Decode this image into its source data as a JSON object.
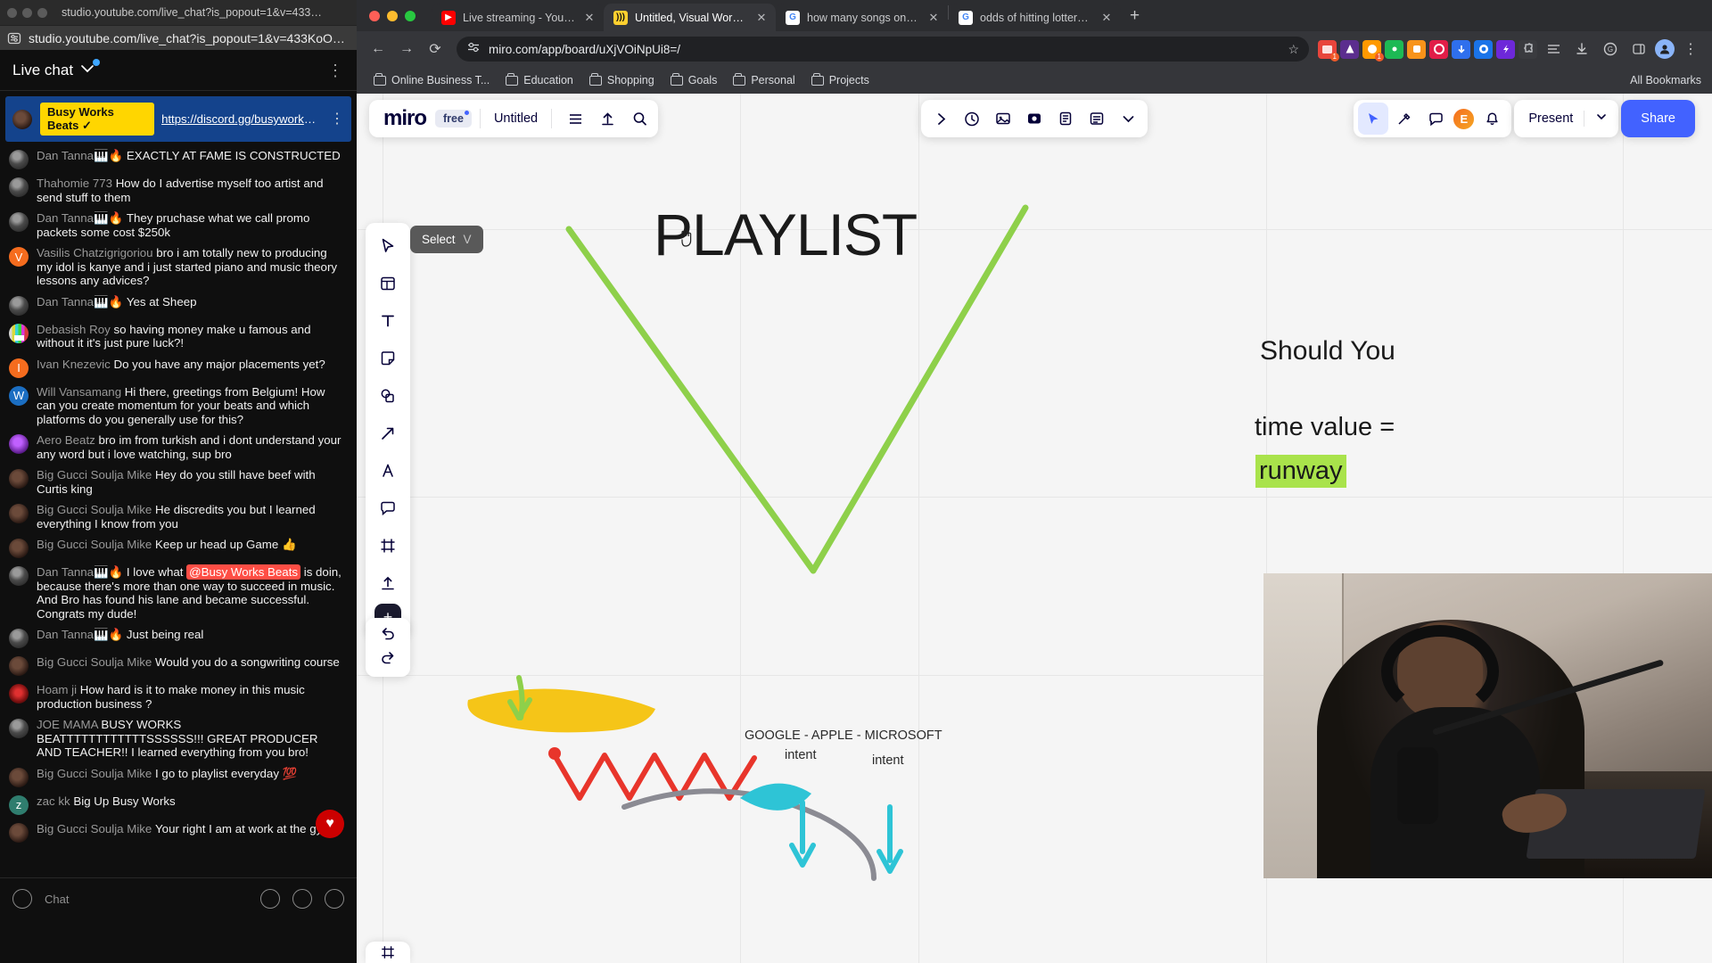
{
  "ytchat": {
    "window_titlebar_url": "studio.youtube.com/live_chat?is_popout=1&v=433KoOJW...",
    "address_bar_url": "studio.youtube.com/live_chat?is_popout=1&v=433KoOJW...",
    "header": {
      "title": "Live chat",
      "chevron": "⌄",
      "menu_icon": "⋮"
    },
    "pinned": {
      "author": "Busy Works Beats",
      "verified": "✓",
      "link": "https://discord.gg/busyworksbea...",
      "menu_icon": "⋮"
    },
    "messages": [
      {
        "author": "Dan Tanna🎹🔥",
        "text": "EXACTLY AT FAME IS CONSTRUCTED",
        "avatar": "dark"
      },
      {
        "author": "Thahomie 773",
        "text": "How do I advertise myself too artist and send stuff to them",
        "avatar": "dark"
      },
      {
        "author": "Dan Tanna🎹🔥",
        "text": "They pruchase what we call promo packets some cost $250k",
        "avatar": "dark"
      },
      {
        "author": "Vasilis Chatzigrigoriou",
        "text": "bro i am totally new to producing my idol is kanye and i just started piano and music theory lessons any advices?",
        "avatar": "orange",
        "letter": "V"
      },
      {
        "author": "Dan Tanna🎹🔥",
        "text": "Yes at Sheep",
        "avatar": "dark"
      },
      {
        "author": "Debasish Roy",
        "text": "so having money make u famous and without it it's just pure luck?!",
        "avatar": "bars"
      },
      {
        "author": "Ivan Knezevic",
        "text": "Do you have any major placements yet?",
        "avatar": "orange",
        "letter": "I"
      },
      {
        "author": "Will Vansamang",
        "text": "Hi there, greetings from Belgium! How can you create momentum for your beats and which platforms do you generally use for this?",
        "avatar": "blue",
        "letter": "W"
      },
      {
        "author": "Aero Beatz",
        "text": "bro im from turkish and i dont understand your any word but i love watching, sup bro",
        "avatar": "purple"
      },
      {
        "author": "Big Gucci Soulja Mike",
        "text": "Hey do you still have beef with Curtis king",
        "avatar": "photo"
      },
      {
        "author": "Big Gucci Soulja Mike",
        "text": "He discredits you but I learned everything I know from you",
        "avatar": "photo"
      },
      {
        "author": "Big Gucci Soulja Mike",
        "text": "Keep ur head up Game  👍",
        "avatar": "photo"
      },
      {
        "author": "Dan Tanna🎹🔥",
        "text_before": "I love what ",
        "mention": "@Busy Works Beats",
        "text_after": " is doin, because there's more than one way to succeed in music. And Bro has found his lane and became successful. Congrats my dude!",
        "avatar": "dark"
      },
      {
        "author": "Dan Tanna🎹🔥",
        "text": "Just being real",
        "avatar": "dark"
      },
      {
        "author": "Big Gucci Soulja Mike",
        "text": "Would you do a songwriting course",
        "avatar": "photo"
      },
      {
        "author": "Hoam ji",
        "text": "How hard is it to make money in this music production business ?",
        "avatar": "red"
      },
      {
        "author": "JOE MAMA",
        "text": "BUSY WORKS BEATTTTTTTTTTTTSSSSSS!!! GREAT PRODUCER AND TEACHER!! I learned everything from you bro!",
        "avatar": "dark"
      },
      {
        "author": "Big Gucci Soulja Mike",
        "text": "I go to playlist everyday 💯",
        "avatar": "photo"
      },
      {
        "author": "zac kk",
        "text": "Big Up Busy Works",
        "avatar": "z",
        "letter": "z"
      },
      {
        "author": "Big Gucci Soulja Mike",
        "text": "Your right I am at work at the gym",
        "avatar": "photo"
      }
    ],
    "heart_button_icon": "♥",
    "footer": {
      "chat_label": "Chat",
      "icons": [
        "emoji-icon",
        "gif-icon",
        "dollar-icon"
      ]
    }
  },
  "browser": {
    "window_controls": [
      "close",
      "minimize",
      "maximize"
    ],
    "tabs": [
      {
        "title": "Live streaming - YouTube Stu",
        "favicon": "youtube-icon",
        "active": false,
        "close": "✕"
      },
      {
        "title": "Untitled, Visual Workspace fo",
        "favicon": "miro-icon",
        "active": true,
        "close": "✕"
      },
      {
        "title": "how many songs on spotify -",
        "favicon": "google-icon",
        "active": false,
        "close": "✕"
      },
      {
        "title": "odds of hitting lottery - Goog",
        "favicon": "google-icon",
        "active": false,
        "close": "✕"
      }
    ],
    "new_tab_icon": "+",
    "nav": {
      "back": "←",
      "forward": "→",
      "reload": "⟳",
      "site_info": "site-settings-icon",
      "url": "miro.com/app/board/uXjVOiNpUi8=/",
      "bookmark_star": "☆"
    },
    "bookmarks": [
      {
        "label": "Online Business T..."
      },
      {
        "label": "Education"
      },
      {
        "label": "Shopping"
      },
      {
        "label": "Goals"
      },
      {
        "label": "Personal"
      },
      {
        "label": "Projects"
      }
    ],
    "all_bookmarks_label": "All Bookmarks"
  },
  "miro": {
    "logo": "miro",
    "plan_chip": "free",
    "board_title": "Untitled",
    "topbar_icons": [
      "menu-icon",
      "upload-icon",
      "search-icon"
    ],
    "center_tools": [
      "chevron-right-icon",
      "timer-icon",
      "frame-icon",
      "focus-icon",
      "voting-icon",
      "notes-icon",
      "chevron-down-icon"
    ],
    "right_tools": [
      "cursor-icon",
      "magic-icon",
      "comment-icon"
    ],
    "user_initial": "E",
    "notification_icon": "bell-icon",
    "present_label": "Present",
    "present_chevron": "⌄",
    "share_label": "Share",
    "tooltip": {
      "label": "Select",
      "shortcut": "V"
    },
    "toolbar_tools": [
      "cursor-select-icon",
      "templates-icon",
      "text-icon",
      "sticky-note-icon",
      "shapes-icon",
      "arrow-icon",
      "pen-icon",
      "comment-icon",
      "frame-icon",
      "upload-icon",
      "more-apps-icon"
    ],
    "history_tools": [
      "undo-icon",
      "redo-icon"
    ],
    "canvas": {
      "title": "PLAYLIST",
      "right_text_1": "Should You",
      "right_text_2": "time value =",
      "highlight_text": "runway",
      "label_companies": "GOOGLE - APPLE - MICROSOFT",
      "label_intent_1": "intent",
      "label_intent_2": "intent",
      "chart_color": "#8ed04a",
      "highlight_color": "#a9e34b",
      "yellow_color": "#f5c518",
      "red_color": "#e8352b",
      "cyan_color": "#2ec4d6",
      "cursor": "grab-hand-icon"
    }
  },
  "webcam": {
    "present": true,
    "description": "streamer-video-overlay"
  }
}
